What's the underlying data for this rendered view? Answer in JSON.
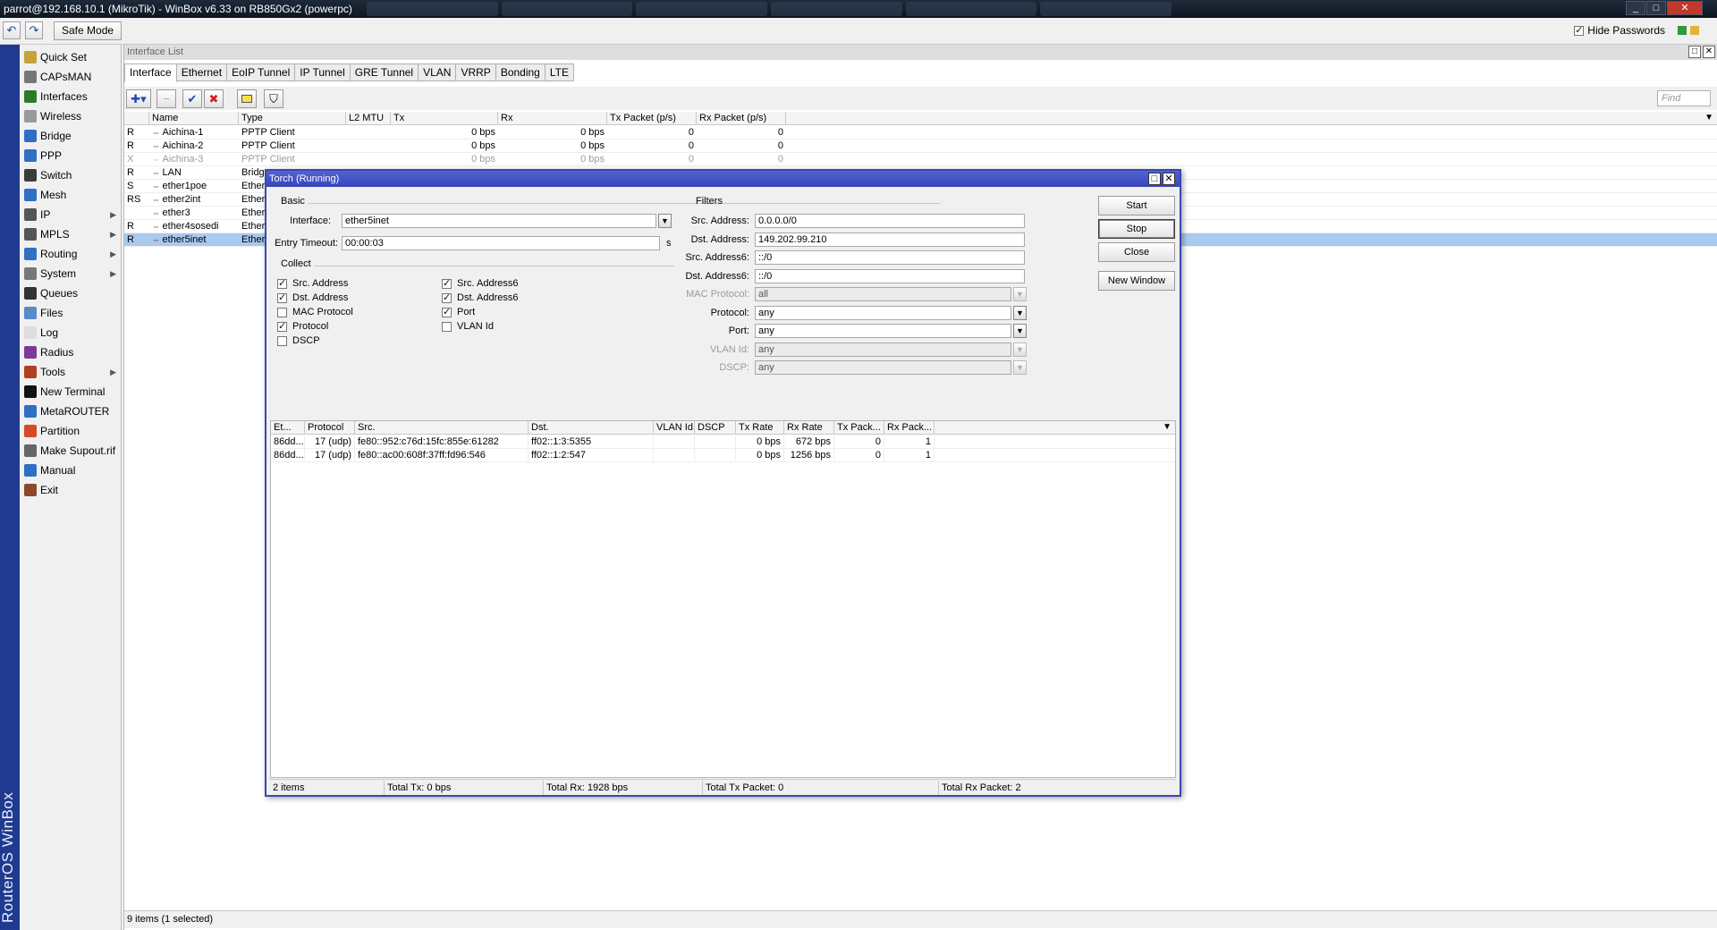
{
  "window": {
    "title": "parrot@192.168.10.1 (MikroTik) - WinBox v6.33 on RB850Gx2 (powerpc)",
    "controls": [
      "_",
      "□",
      "✕"
    ]
  },
  "toolbar": {
    "undo_icon": "↶",
    "redo_icon": "↷",
    "safe_mode": "Safe Mode",
    "hide_passwords": "Hide Passwords"
  },
  "branding": "RouterOS WinBox",
  "sidebar": {
    "items": [
      {
        "label": "Quick Set",
        "icon": "quickset-icon",
        "color": "#c8a23a",
        "sub": false
      },
      {
        "label": "CAPsMAN",
        "icon": "capsman-icon",
        "color": "#777777",
        "sub": false
      },
      {
        "label": "Interfaces",
        "icon": "interfaces-icon",
        "color": "#2d7a2d",
        "sub": false
      },
      {
        "label": "Wireless",
        "icon": "wireless-icon",
        "color": "#999999",
        "sub": false
      },
      {
        "label": "Bridge",
        "icon": "bridge-icon",
        "color": "#2f6fc4",
        "sub": false
      },
      {
        "label": "PPP",
        "icon": "ppp-icon",
        "color": "#2f6fc4",
        "sub": false
      },
      {
        "label": "Switch",
        "icon": "switch-icon",
        "color": "#3b3b3b",
        "sub": false
      },
      {
        "label": "Mesh",
        "icon": "mesh-icon",
        "color": "#2f6fc4",
        "sub": false
      },
      {
        "label": "IP",
        "icon": "ip-icon",
        "color": "#555555",
        "sub": true
      },
      {
        "label": "MPLS",
        "icon": "mpls-icon",
        "color": "#555555",
        "sub": true
      },
      {
        "label": "Routing",
        "icon": "routing-icon",
        "color": "#2f6fc4",
        "sub": true
      },
      {
        "label": "System",
        "icon": "system-icon",
        "color": "#777777",
        "sub": true
      },
      {
        "label": "Queues",
        "icon": "queues-icon",
        "color": "#333333",
        "sub": false
      },
      {
        "label": "Files",
        "icon": "files-icon",
        "color": "#5a8ac8",
        "sub": false
      },
      {
        "label": "Log",
        "icon": "log-icon",
        "color": "#dddddd",
        "sub": false
      },
      {
        "label": "Radius",
        "icon": "radius-icon",
        "color": "#7a3a9a",
        "sub": false
      },
      {
        "label": "Tools",
        "icon": "tools-icon",
        "color": "#b04020",
        "sub": true
      },
      {
        "label": "New Terminal",
        "icon": "terminal-icon",
        "color": "#111111",
        "sub": false
      },
      {
        "label": "MetaROUTER",
        "icon": "metarouter-icon",
        "color": "#2f6fc4",
        "sub": false
      },
      {
        "label": "Partition",
        "icon": "partition-icon",
        "color": "#d44a2a",
        "sub": false
      },
      {
        "label": "Make Supout.rif",
        "icon": "supout-icon",
        "color": "#666666",
        "sub": false
      },
      {
        "label": "Manual",
        "icon": "manual-icon",
        "color": "#2f6fc4",
        "sub": false
      },
      {
        "label": "Exit",
        "icon": "exit-icon",
        "color": "#8a4a2a",
        "sub": false
      }
    ]
  },
  "interface_list": {
    "title": "Interface List",
    "tabs": [
      "Interface",
      "Ethernet",
      "EoIP Tunnel",
      "IP Tunnel",
      "GRE Tunnel",
      "VLAN",
      "VRRP",
      "Bonding",
      "LTE"
    ],
    "find_placeholder": "Find",
    "columns": [
      "",
      "Name",
      "Type",
      "L2 MTU",
      "Tx",
      "Rx",
      "Tx Packet (p/s)",
      "Rx Packet (p/s)"
    ],
    "rows": [
      {
        "flag": "R",
        "name": "Aichina-1",
        "type": "PPTP Client",
        "mtu": "",
        "tx": "0 bps",
        "rx": "0 bps",
        "txp": "0",
        "rxp": "0"
      },
      {
        "flag": "R",
        "name": "Aichina-2",
        "type": "PPTP Client",
        "mtu": "",
        "tx": "0 bps",
        "rx": "0 bps",
        "txp": "0",
        "rxp": "0"
      },
      {
        "flag": "X",
        "name": "Aichina-3",
        "type": "PPTP Client",
        "mtu": "",
        "tx": "0 bps",
        "rx": "0 bps",
        "txp": "0",
        "rxp": "0"
      },
      {
        "flag": "R",
        "name": "LAN",
        "type": "Bridge",
        "mtu": "",
        "tx": "",
        "rx": "",
        "txp": "",
        "rxp": ""
      },
      {
        "flag": "S",
        "name": "ether1poe",
        "type": "Ethern",
        "mtu": "",
        "tx": "",
        "rx": "",
        "txp": "",
        "rxp": ""
      },
      {
        "flag": "RS",
        "name": "ether2int",
        "type": "Ethern",
        "mtu": "",
        "tx": "",
        "rx": "",
        "txp": "",
        "rxp": ""
      },
      {
        "flag": "",
        "name": "ether3",
        "type": "Ethern",
        "mtu": "",
        "tx": "",
        "rx": "",
        "txp": "",
        "rxp": ""
      },
      {
        "flag": "R",
        "name": "ether4sosedi",
        "type": "Ethern",
        "mtu": "",
        "tx": "",
        "rx": "",
        "txp": "",
        "rxp": ""
      },
      {
        "flag": "R",
        "name": "ether5inet",
        "type": "Ethern",
        "mtu": "",
        "tx": "",
        "rx": "",
        "txp": "",
        "rxp": ""
      }
    ],
    "status": "9 items (1 selected)"
  },
  "torch": {
    "title": "Torch (Running)",
    "basic_label": "Basic",
    "interface_label": "Interface:",
    "interface_value": "ether5inet",
    "entry_timeout_label": "Entry Timeout:",
    "entry_timeout_value": "00:00:03",
    "entry_timeout_unit": "s",
    "collect_label": "Collect",
    "collect": [
      {
        "label": "Src. Address",
        "checked": true
      },
      {
        "label": "Dst. Address",
        "checked": true
      },
      {
        "label": "MAC Protocol",
        "checked": false
      },
      {
        "label": "Protocol",
        "checked": true
      },
      {
        "label": "DSCP",
        "checked": false
      },
      {
        "label": "Src. Address6",
        "checked": true
      },
      {
        "label": "Dst. Address6",
        "checked": true
      },
      {
        "label": "Port",
        "checked": true
      },
      {
        "label": "VLAN Id",
        "checked": false
      }
    ],
    "filters_label": "Filters",
    "filters": [
      {
        "label": "Src. Address:",
        "value": "0.0.0.0/0",
        "dropdown": false,
        "disabled": false
      },
      {
        "label": "Dst. Address:",
        "value": "149.202.99.210",
        "dropdown": false,
        "disabled": false
      },
      {
        "label": "Src. Address6:",
        "value": "::/0",
        "dropdown": false,
        "disabled": false
      },
      {
        "label": "Dst. Address6:",
        "value": "::/0",
        "dropdown": false,
        "disabled": false
      },
      {
        "label": "MAC Protocol:",
        "value": "all",
        "dropdown": true,
        "disabled": true
      },
      {
        "label": "Protocol:",
        "value": "any",
        "dropdown": true,
        "disabled": false
      },
      {
        "label": "Port:",
        "value": "any",
        "dropdown": true,
        "disabled": false
      },
      {
        "label": "VLAN Id:",
        "value": "any",
        "dropdown": true,
        "disabled": true
      },
      {
        "label": "DSCP:",
        "value": "any",
        "dropdown": true,
        "disabled": true
      }
    ],
    "buttons": {
      "start": "Start",
      "stop": "Stop",
      "close": "Close",
      "new_window": "New Window"
    },
    "columns": [
      "Et...",
      "Protocol",
      "Src.",
      "Dst.",
      "VLAN Id",
      "DSCP",
      "Tx Rate",
      "Rx Rate",
      "Tx Pack...",
      "Rx Pack..."
    ],
    "rows": [
      {
        "eth": "86dd...",
        "proto": "17 (udp)",
        "src": "fe80::952:c76d:15fc:855e:61282",
        "dst": "ff02::1:3:5355",
        "vlan": "",
        "dscp": "",
        "tx": "0 bps",
        "rx": "672 bps",
        "txp": "0",
        "rxp": "1"
      },
      {
        "eth": "86dd...",
        "proto": "17 (udp)",
        "src": "fe80::ac00:608f:37ff:fd96:546",
        "dst": "ff02::1:2:547",
        "vlan": "",
        "dscp": "",
        "tx": "0 bps",
        "rx": "1256 bps",
        "txp": "0",
        "rxp": "1"
      }
    ],
    "status": {
      "items": "2 items",
      "total_tx": "Total Tx: 0 bps",
      "total_rx": "Total Rx: 1928 bps",
      "total_tx_packet": "Total Tx Packet: 0",
      "total_rx_packet": "Total Rx Packet: 2"
    }
  }
}
